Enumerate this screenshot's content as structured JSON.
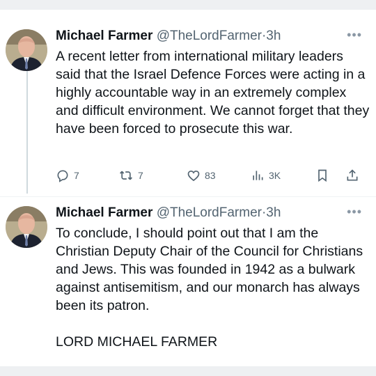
{
  "tweets": [
    {
      "name": "Michael Farmer",
      "handle": "@TheLordFarmer",
      "time": "3h",
      "text": "A recent letter from international military leaders said that the Israel Defence Forces were acting in a highly accountable way in an extremely complex and difficult environment. We cannot forget that they have been forced to prosecute this war.",
      "replies": "7",
      "retweets": "7",
      "likes": "83",
      "views": "3K"
    },
    {
      "name": "Michael Farmer",
      "handle": "@TheLordFarmer",
      "time": "3h",
      "text": "To conclude, I should point out that I am the Christian Deputy Chair of the Council for Christians and Jews. This was founded in 1942 as a bulwark against antisemitism, and our monarch has always been its patron.",
      "signature": "LORD MICHAEL FARMER"
    }
  ],
  "separator": "·",
  "more_glyph": "•••",
  "colors": {
    "text": "#0f1419",
    "secondary": "#536471",
    "thread_line": "#cfd9de"
  }
}
